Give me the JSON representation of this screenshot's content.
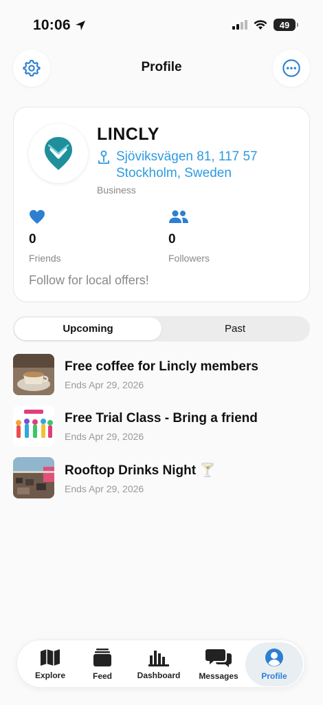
{
  "status": {
    "time": "10:06",
    "battery": "49"
  },
  "header": {
    "title": "Profile"
  },
  "profile": {
    "name": "LINCLY",
    "address_line1": "Sjöviksvägen 81, 117 57",
    "address_line2": "Stockholm, Sweden",
    "type": "Business",
    "friends_count": "0",
    "friends_label": "Friends",
    "followers_count": "0",
    "followers_label": "Followers",
    "tagline": "Follow for local offers!"
  },
  "segments": {
    "upcoming": "Upcoming",
    "past": "Past",
    "active": "Upcoming"
  },
  "offers": [
    {
      "title": "Free coffee for Lincly members",
      "ends": "Ends Apr 29, 2026"
    },
    {
      "title": "Free Trial Class - Bring a friend",
      "ends": "Ends Apr 29, 2026"
    },
    {
      "title": "Rooftop Drinks Night 🍸",
      "ends": "Ends Apr 29, 2026"
    }
  ],
  "tabs": [
    {
      "label": "Explore",
      "icon": "map-icon"
    },
    {
      "label": "Feed",
      "icon": "feed-icon"
    },
    {
      "label": "Dashboard",
      "icon": "bar-chart-icon"
    },
    {
      "label": "Messages",
      "icon": "chat-bubbles-icon"
    },
    {
      "label": "Profile",
      "icon": "person-icon"
    }
  ],
  "colors": {
    "accent": "#2d9ae0",
    "brand_teal": "#1f8f9c"
  }
}
